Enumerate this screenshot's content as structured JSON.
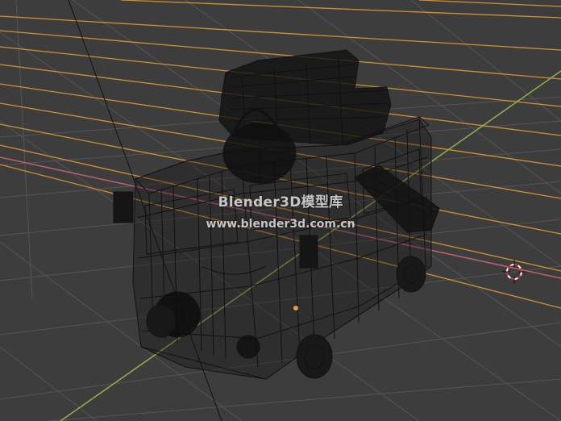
{
  "viewport": {
    "mode": "wireframe",
    "background_color": "#3d3d3d",
    "grid_color": "#555555",
    "x_axis_color": "#c06070",
    "y_axis_color": "#8fb24a",
    "reference_line_color": "#e59a2e",
    "cursor_color": "#d8303a",
    "origin_color": "#f29a3a"
  },
  "model": {
    "description_icon": "van-wireframe-icon",
    "wire_color": "#111111"
  },
  "watermark": {
    "title": "Blender3D模型库",
    "url": "www.blender3d.com.cn"
  }
}
